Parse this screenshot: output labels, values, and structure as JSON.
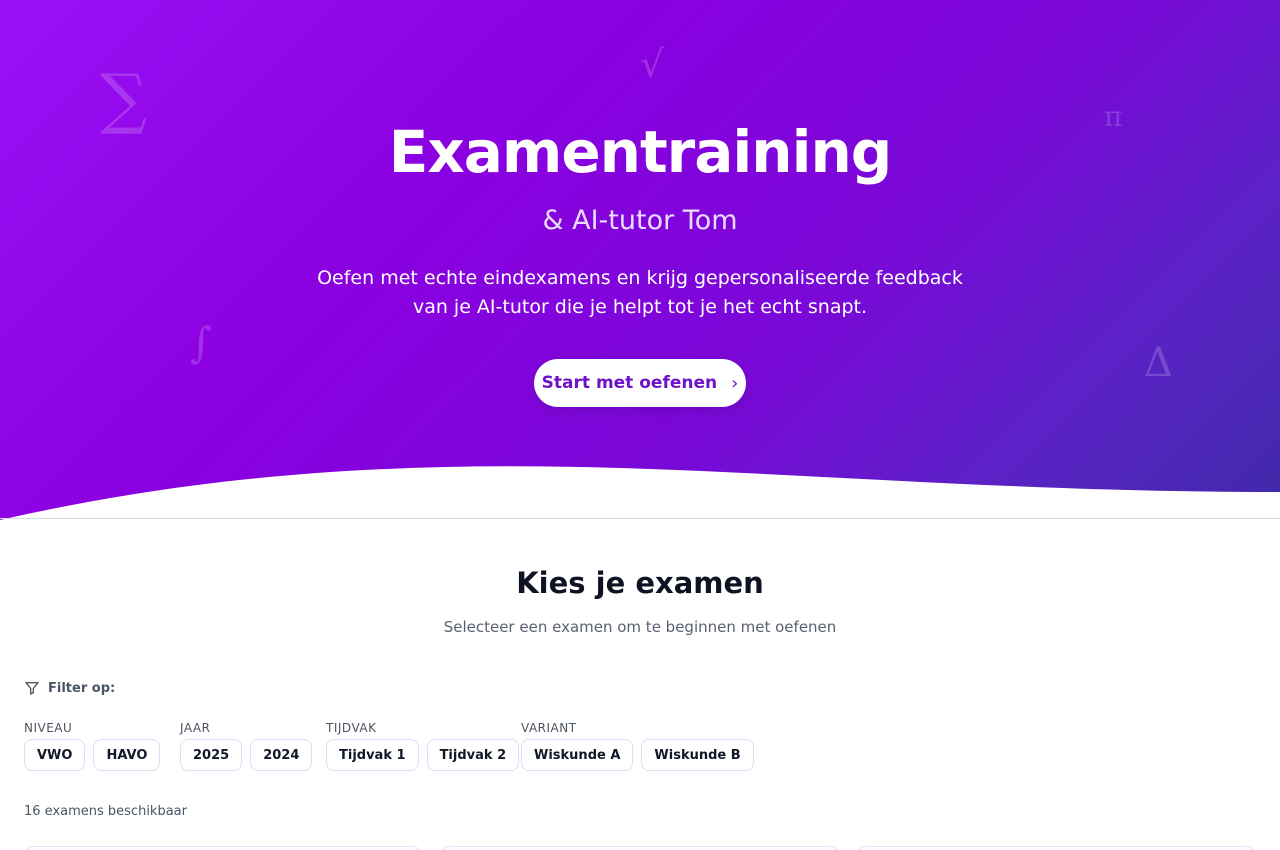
{
  "hero": {
    "title": "Examentraining",
    "subtitle": "& AI-tutor Tom",
    "description": "Oefen met echte eindexamens en krijg gepersonaliseerde feedback van je AI-tutor die je helpt tot je het echt snapt.",
    "cta_label": "Start met oefenen",
    "decorations": [
      "∑",
      "√",
      "π",
      "∫",
      "Δ"
    ]
  },
  "section": {
    "title": "Kies je examen",
    "subtitle": "Selecteer een examen om te beginnen met oefenen"
  },
  "filters": {
    "label": "Filter op:",
    "groups": [
      {
        "label": "Niveau",
        "options": [
          "VWO",
          "HAVO"
        ]
      },
      {
        "label": "Jaar",
        "options": [
          "2025",
          "2024"
        ]
      },
      {
        "label": "Tijdvak",
        "options": [
          "Tijdvak 1",
          "Tijdvak 2"
        ]
      },
      {
        "label": "Variant",
        "options": [
          "Wiskunde A",
          "Wiskunde B"
        ]
      }
    ]
  },
  "results": {
    "count_text": "16 examens beschikbaar"
  },
  "colors": {
    "hero_start": "#9b10f5",
    "hero_end": "#3f2aa8",
    "cta_text": "#6d12c9"
  }
}
